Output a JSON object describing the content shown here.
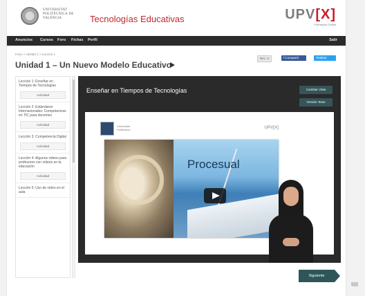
{
  "header": {
    "university_name": "Universitat Politècnica de València",
    "site_title": "Tecnologías Educativas",
    "brand": {
      "logo_prefix": "UPV",
      "logo_suffix": "[X]",
      "subtitle": "Formación Online"
    }
  },
  "nav": {
    "items": [
      "Anuncios",
      "Cursos",
      "Foro",
      "Fichas",
      "Perfil"
    ],
    "logout": "Salir"
  },
  "breadcrumb": "Inicio > Unidad 1 > Lección 1",
  "page_title": "Unidad 1 – Un Nuevo Modelo Educativo",
  "share": {
    "recommend": "Rec. 0",
    "facebook": "f Compartir",
    "twitter": "Twittear"
  },
  "sidebar": {
    "lessons": [
      {
        "title": "Lección 1: Enseñar en Tiempos de Tecnologías",
        "activity": "Actividad"
      },
      {
        "title": "Lección 2: Estándares Internacionales: Competencias en TIC para docentes",
        "activity": "Actividad"
      },
      {
        "title": "Lección 3: Competencia Digital",
        "activity": "Actividad"
      },
      {
        "title": "Lección 4: Algunos videos para profesores con vídeos en la educación",
        "activity": "Actividad"
      },
      {
        "title": "Lección 5: Uso de vídeo en el aula",
        "activity": ""
      }
    ]
  },
  "video": {
    "title": "Enseñar en Tiempos de Tecnologías",
    "change_view_label": "Cambiar Vista",
    "version_label": "Versión Texto",
    "slide_logo": "UPV[X]",
    "slide_badge_text": "Universitat Politècnica",
    "slide_word": "Procesual"
  },
  "next_label": "Siguiente",
  "colors": {
    "brand_red": "#c0282e",
    "nav_bg": "#2b2b2b",
    "button_teal": "#355558",
    "panel_dark": "#2a2a2a"
  },
  "icons": [
    "university-seal-icon",
    "play-icon",
    "title-arrow-icon",
    "next-arrow-icon"
  ]
}
